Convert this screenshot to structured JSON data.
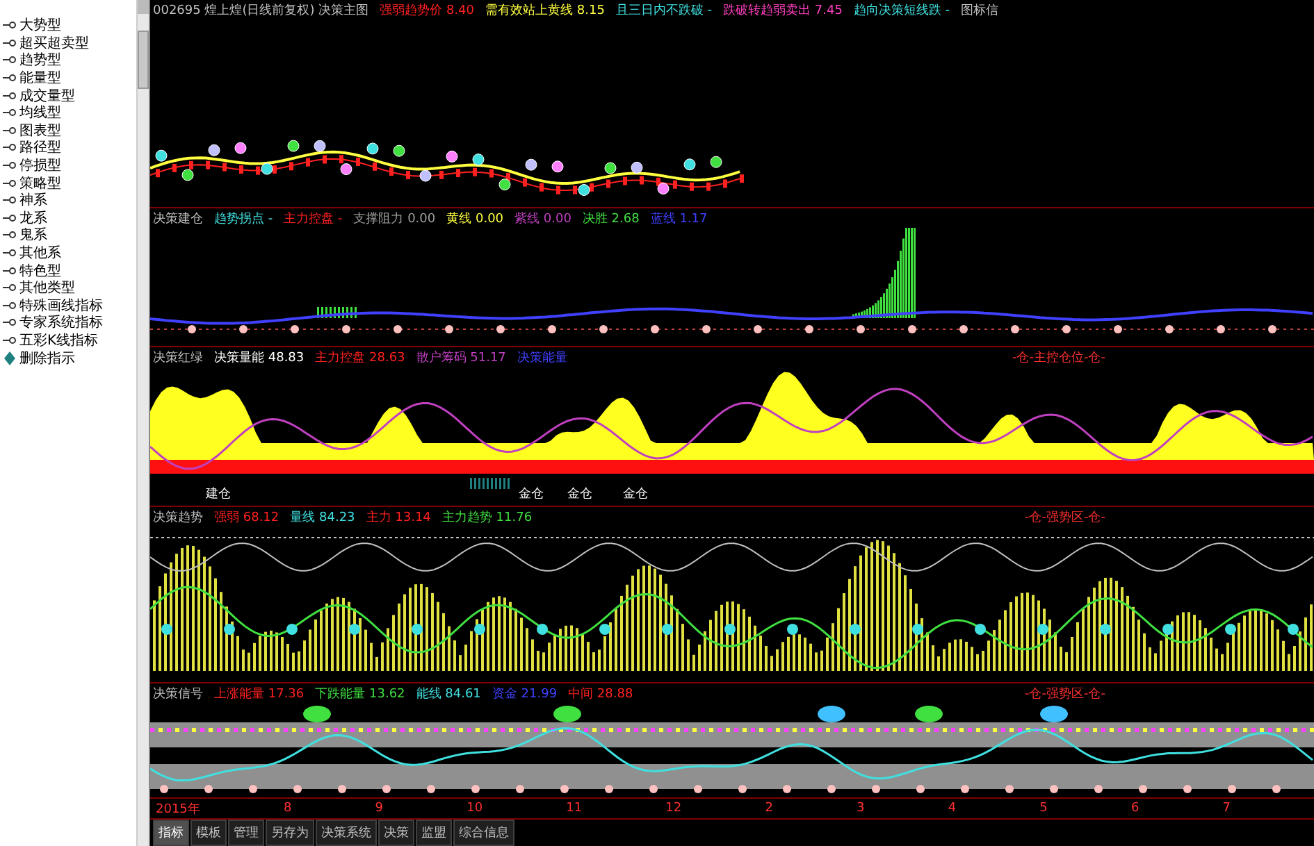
{
  "sidebar": {
    "items": [
      {
        "label": "大势型",
        "kind": "indicator"
      },
      {
        "label": "超买超卖型",
        "kind": "indicator"
      },
      {
        "label": "趋势型",
        "kind": "indicator"
      },
      {
        "label": "能量型",
        "kind": "indicator"
      },
      {
        "label": "成交量型",
        "kind": "indicator"
      },
      {
        "label": "均线型",
        "kind": "indicator"
      },
      {
        "label": "图表型",
        "kind": "indicator"
      },
      {
        "label": "路径型",
        "kind": "indicator"
      },
      {
        "label": "停损型",
        "kind": "indicator"
      },
      {
        "label": "策略型",
        "kind": "indicator"
      },
      {
        "label": "神系",
        "kind": "indicator"
      },
      {
        "label": "龙系",
        "kind": "indicator"
      },
      {
        "label": "鬼系",
        "kind": "indicator"
      },
      {
        "label": "其他系",
        "kind": "indicator"
      },
      {
        "label": "特色型",
        "kind": "indicator"
      },
      {
        "label": "其他类型",
        "kind": "indicator"
      },
      {
        "label": "特殊画线指标",
        "kind": "indicator"
      },
      {
        "label": "专家系统指标",
        "kind": "indicator"
      },
      {
        "label": "五彩K线指标",
        "kind": "indicator"
      },
      {
        "label": "删除指示",
        "kind": "action"
      }
    ]
  },
  "panels": [
    {
      "kind": "kline",
      "header": [
        {
          "text": "002695 煌上煌(日线前复权) 决策主图",
          "color": "#c0c0c0"
        },
        {
          "text": "强弱趋势价 8.40",
          "color": "#ff2020"
        },
        {
          "text": "需有效站上黄线 8.15",
          "color": "#ffff40"
        },
        {
          "text": "且三日内不跌破 -",
          "color": "#40e0e0"
        },
        {
          "text": "跌破转趋弱卖出 7.45",
          "color": "#ff40c0"
        },
        {
          "text": "趋向决策短线跌 -",
          "color": "#40e0e0"
        },
        {
          "text": "图标信",
          "color": "#c0c0c0"
        }
      ]
    },
    {
      "kind": "histogram",
      "header": [
        {
          "text": "决策建仓",
          "color": "#c0c0c0"
        },
        {
          "text": "趋势拐点 -",
          "color": "#40e0e0"
        },
        {
          "text": "主力控盘 -",
          "color": "#ff2020"
        },
        {
          "text": "支撑阻力 0.00",
          "color": "#a0a0a0"
        },
        {
          "text": "黄线 0.00",
          "color": "#ffff40"
        },
        {
          "text": "紫线 0.00",
          "color": "#c040c0"
        },
        {
          "text": "决胜 2.68",
          "color": "#40e040"
        },
        {
          "text": "蓝线 1.17",
          "color": "#4040ff"
        }
      ]
    },
    {
      "kind": "area",
      "header": [
        {
          "text": "决策红绿",
          "color": "#c0c0c0"
        },
        {
          "text": "决策量能 48.83",
          "color": "#ffffff"
        },
        {
          "text": "主力控盘 28.63",
          "color": "#ff2020"
        },
        {
          "text": "散户筹码 51.17",
          "color": "#c040c0"
        },
        {
          "text": "决策能量",
          "color": "#4040ff"
        }
      ],
      "labels": [
        "建仓",
        "金仓",
        "金仓",
        "金仓"
      ],
      "note": "-仓-主控仓位-仓-"
    },
    {
      "kind": "bars",
      "header": [
        {
          "text": "决策趋势",
          "color": "#c0c0c0"
        },
        {
          "text": "强弱 68.12",
          "color": "#ff2020"
        },
        {
          "text": "量线 84.23",
          "color": "#40e0e0"
        },
        {
          "text": "主力 13.14",
          "color": "#ff2020"
        },
        {
          "text": "主力趋势 11.76",
          "color": "#40e040"
        }
      ],
      "note": "-仓-强势区-仓-"
    },
    {
      "kind": "bands",
      "header": [
        {
          "text": "决策信号",
          "color": "#c0c0c0"
        },
        {
          "text": "上涨能量 17.36",
          "color": "#ff2020"
        },
        {
          "text": "下跌能量 13.62",
          "color": "#40e040"
        },
        {
          "text": "能线 84.61",
          "color": "#40e0e0"
        },
        {
          "text": "资金 21.99",
          "color": "#4040ff"
        },
        {
          "text": "中间 28.88",
          "color": "#ff2020"
        }
      ],
      "note": "-仓-强势区-仓-"
    }
  ],
  "time_axis": [
    "2015年",
    "8",
    "9",
    "10",
    "11",
    "12",
    "2",
    "3",
    "4",
    "5",
    "6",
    "7"
  ],
  "tabs": [
    {
      "label": "指标",
      "selected": true
    },
    {
      "label": "模板",
      "selected": false
    },
    {
      "label": "管理",
      "selected": false
    },
    {
      "label": "另存为",
      "selected": false
    },
    {
      "label": "决策系统",
      "selected": false
    },
    {
      "label": "决策",
      "selected": false
    },
    {
      "label": "监盟",
      "selected": false
    },
    {
      "label": "综合信息",
      "selected": false
    }
  ]
}
